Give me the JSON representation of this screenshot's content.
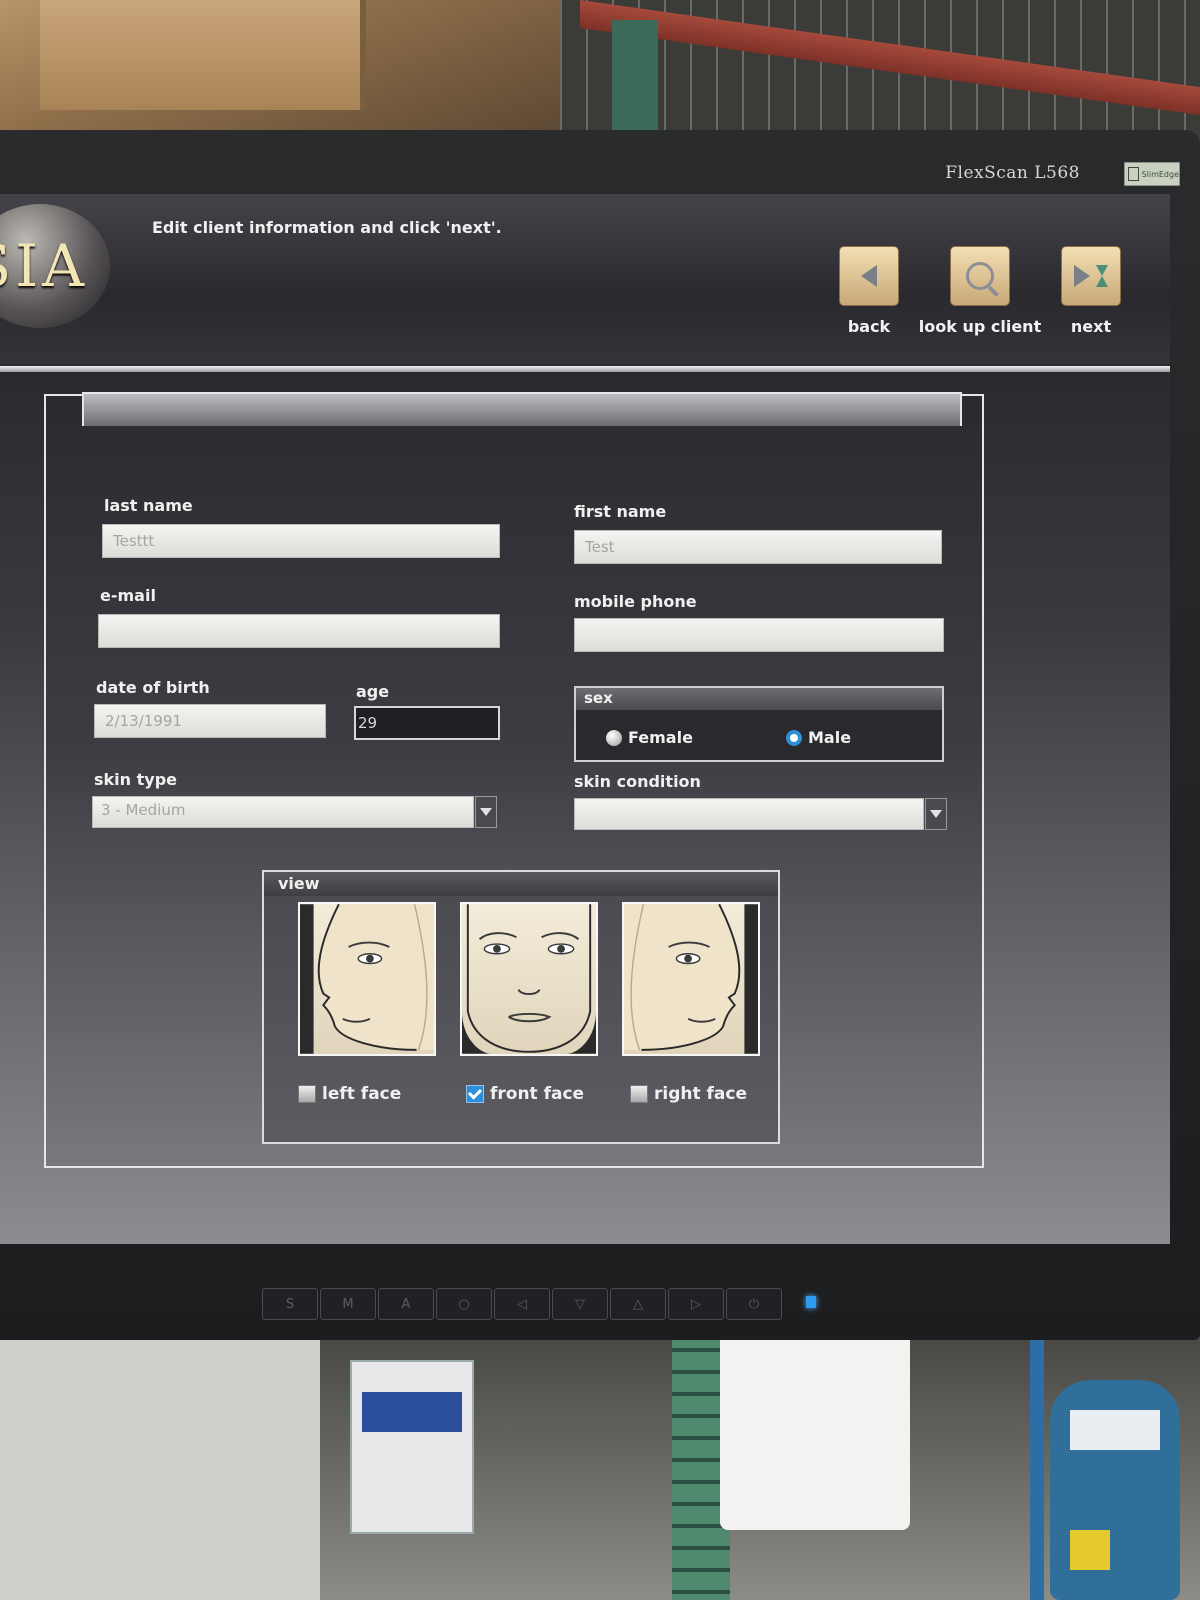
{
  "monitor": {
    "model": "FlexScan L568",
    "badge": "SlimEdge",
    "controls": [
      "S",
      "M",
      "A",
      "○",
      "◁",
      "▽",
      "△",
      "▷",
      "⏻"
    ]
  },
  "app": {
    "logo_text": "SIA",
    "instruction": "Edit client information and click 'next'."
  },
  "toolbar": {
    "back_label": "back",
    "lookup_label": "look up client",
    "next_label": "next"
  },
  "form": {
    "last_name": {
      "label": "last name",
      "value": "Testtt"
    },
    "first_name": {
      "label": "first name",
      "value": "Test"
    },
    "email": {
      "label": "e-mail",
      "value": ""
    },
    "mobile_phone": {
      "label": "mobile phone",
      "value": ""
    },
    "date_of_birth": {
      "label": "date of birth",
      "value": "2/13/1991"
    },
    "age": {
      "label": "age",
      "value": "29"
    },
    "sex": {
      "label": "sex",
      "options": [
        {
          "label": "Female",
          "selected": false
        },
        {
          "label": "Male",
          "selected": true
        }
      ]
    },
    "skin_type": {
      "label": "skin type",
      "value": "3 - Medium"
    },
    "skin_condition": {
      "label": "skin condition",
      "value": ""
    }
  },
  "view": {
    "label": "view",
    "options": [
      {
        "label": "left face",
        "checked": false
      },
      {
        "label": "front face",
        "checked": true
      },
      {
        "label": "right face",
        "checked": false
      }
    ]
  },
  "colors": {
    "accent": "#2d8fd8",
    "nav_button": "#e7cf9f",
    "logo_text": "#f3e6b4"
  }
}
